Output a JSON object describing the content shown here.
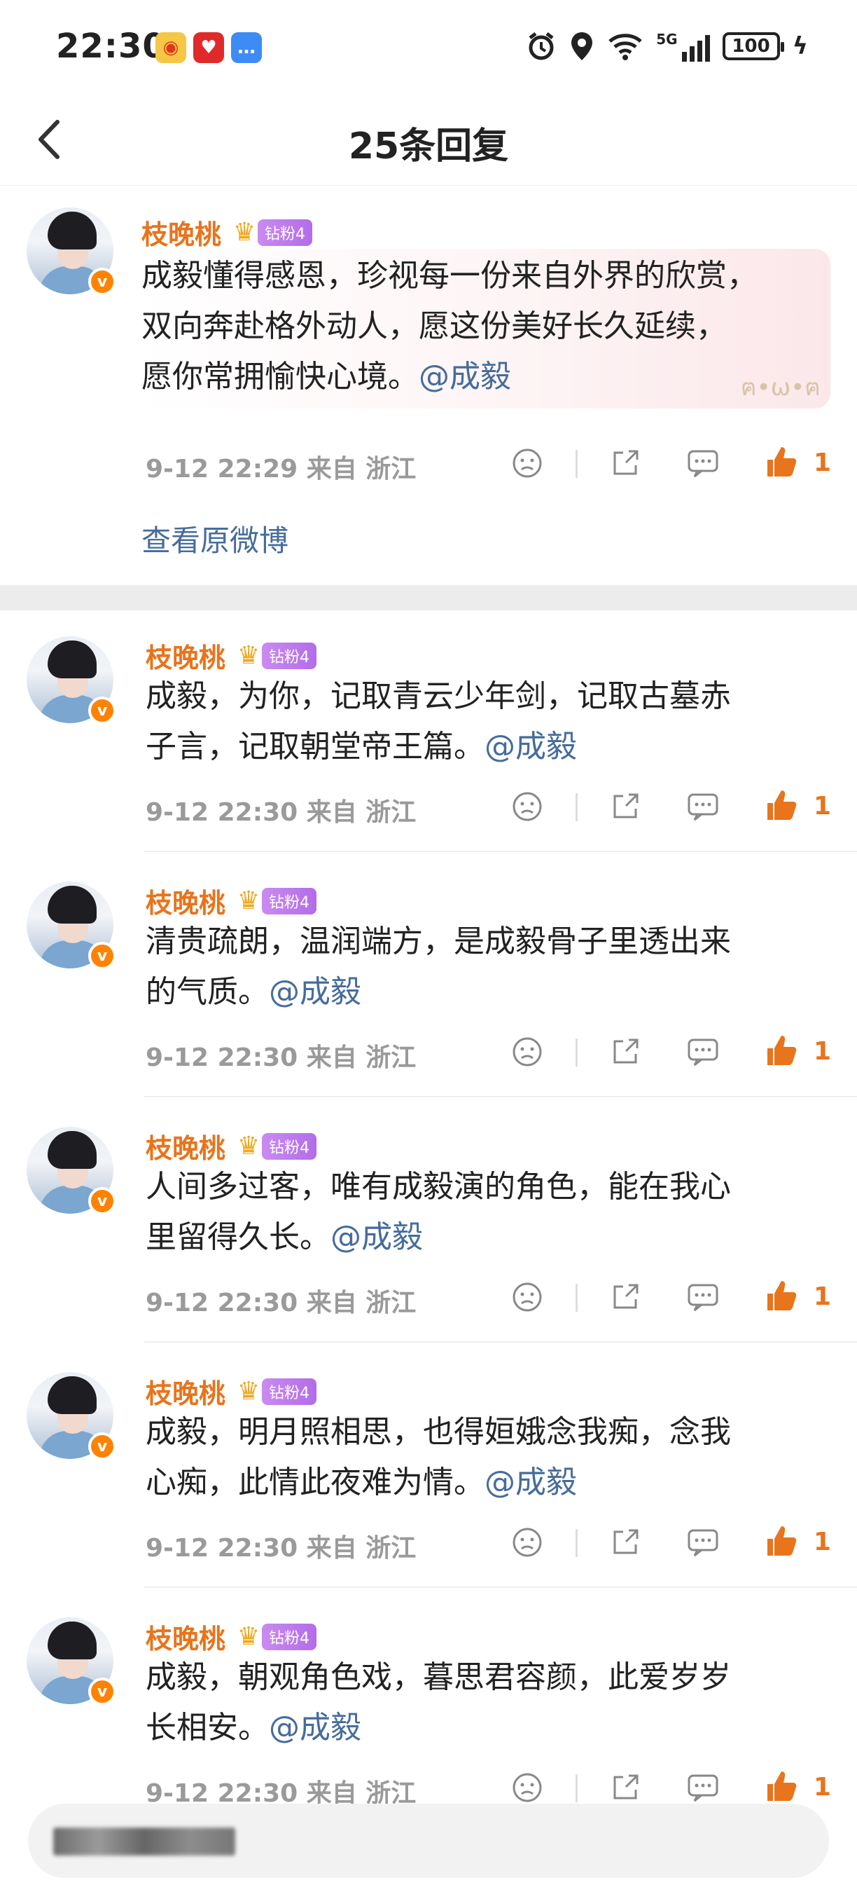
{
  "status_bar": {
    "time": "22:30",
    "network": "5G",
    "battery": "100"
  },
  "header": {
    "title": "25条回复"
  },
  "original": {
    "username": "枝晚桃",
    "fan_badge": "钻粉4",
    "text_line1": "成毅懂得感恩，珍视每一份来自外界的欣赏，",
    "text_line2": "双向奔赴格外动人，愿这份美好长久延续，",
    "text_line3": "愿你常拥愉快心境。",
    "mention": "@成毅",
    "timestamp": "9-12 22:29",
    "location": "来自 浙江",
    "likes": "1",
    "view_original": "查看原微博"
  },
  "replies": [
    {
      "username": "枝晚桃",
      "fan_badge": "钻粉4",
      "line1": "成毅，为你，记取青云少年剑，记取古墓赤",
      "line2": "子言，记取朝堂帝王篇。",
      "mention": "@成毅",
      "timestamp": "9-12 22:30",
      "location": "来自 浙江",
      "likes": "1"
    },
    {
      "username": "枝晚桃",
      "fan_badge": "钻粉4",
      "line1": "清贵疏朗，温润端方，是成毅骨子里透出来",
      "line2": "的气质。",
      "mention": "@成毅",
      "timestamp": "9-12 22:30",
      "location": "来自 浙江",
      "likes": "1"
    },
    {
      "username": "枝晚桃",
      "fan_badge": "钻粉4",
      "line1": "人间多过客，唯有成毅演的角色，能在我心",
      "line2": "里留得久长。",
      "mention": "@成毅",
      "timestamp": "9-12 22:30",
      "location": "来自 浙江",
      "likes": "1"
    },
    {
      "username": "枝晚桃",
      "fan_badge": "钻粉4",
      "line1": "成毅，明月照相思，也得姮娥念我痴，念我",
      "line2": "心痴，此情此夜难为情。",
      "mention": "@成毅",
      "timestamp": "9-12 22:30",
      "location": "来自 浙江",
      "likes": "1"
    },
    {
      "username": "枝晚桃",
      "fan_badge": "钻粉4",
      "line1": "成毅，朝观角色戏，暮思君容颜，此爱岁岁",
      "line2": "长相安。",
      "mention": "@成毅",
      "timestamp": "9-12 22:30",
      "location": "来自 浙江",
      "likes": "1"
    }
  ],
  "colors": {
    "accent_orange": "#e8741c",
    "mention_blue": "#466c9c",
    "meta_gray": "#9a9a9a",
    "verified_orange": "#ff8200"
  },
  "icons": [
    "weibo-app-icon",
    "heart-app-icon",
    "message-app-icon",
    "alarm-icon",
    "location-icon",
    "wifi-icon",
    "signal-icon",
    "battery-icon",
    "back-arrow-icon",
    "dislike-face-icon",
    "share-icon",
    "comment-icon",
    "like-thumb-icon"
  ]
}
